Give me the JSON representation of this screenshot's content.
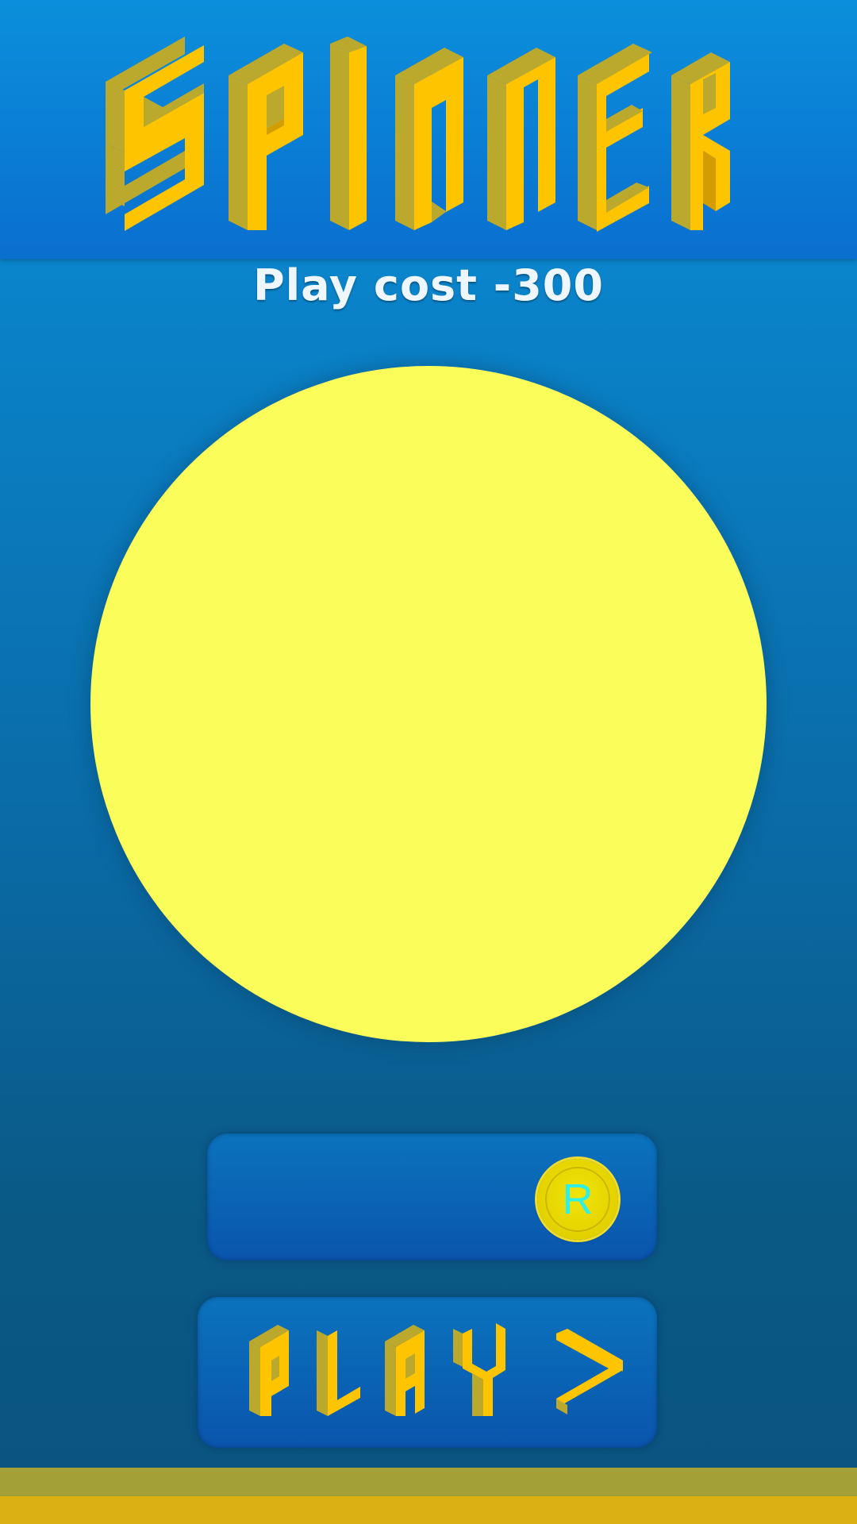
{
  "header": {
    "logo_text": "SPINNER"
  },
  "play_cost": {
    "label": "Play cost -300"
  },
  "currency_panel": {
    "coin_letter": "R"
  },
  "play_button": {
    "label": "PLAY >"
  },
  "colors": {
    "background": "#0a7fc4",
    "wheel": "#fbfd5a",
    "logo_front": "#ffc400",
    "logo_side": "#bba92e",
    "coin": "#e6d400",
    "coin_letter": "#2ef0e6",
    "footer_top": "#a2a036",
    "footer_bottom": "#dbb013"
  }
}
